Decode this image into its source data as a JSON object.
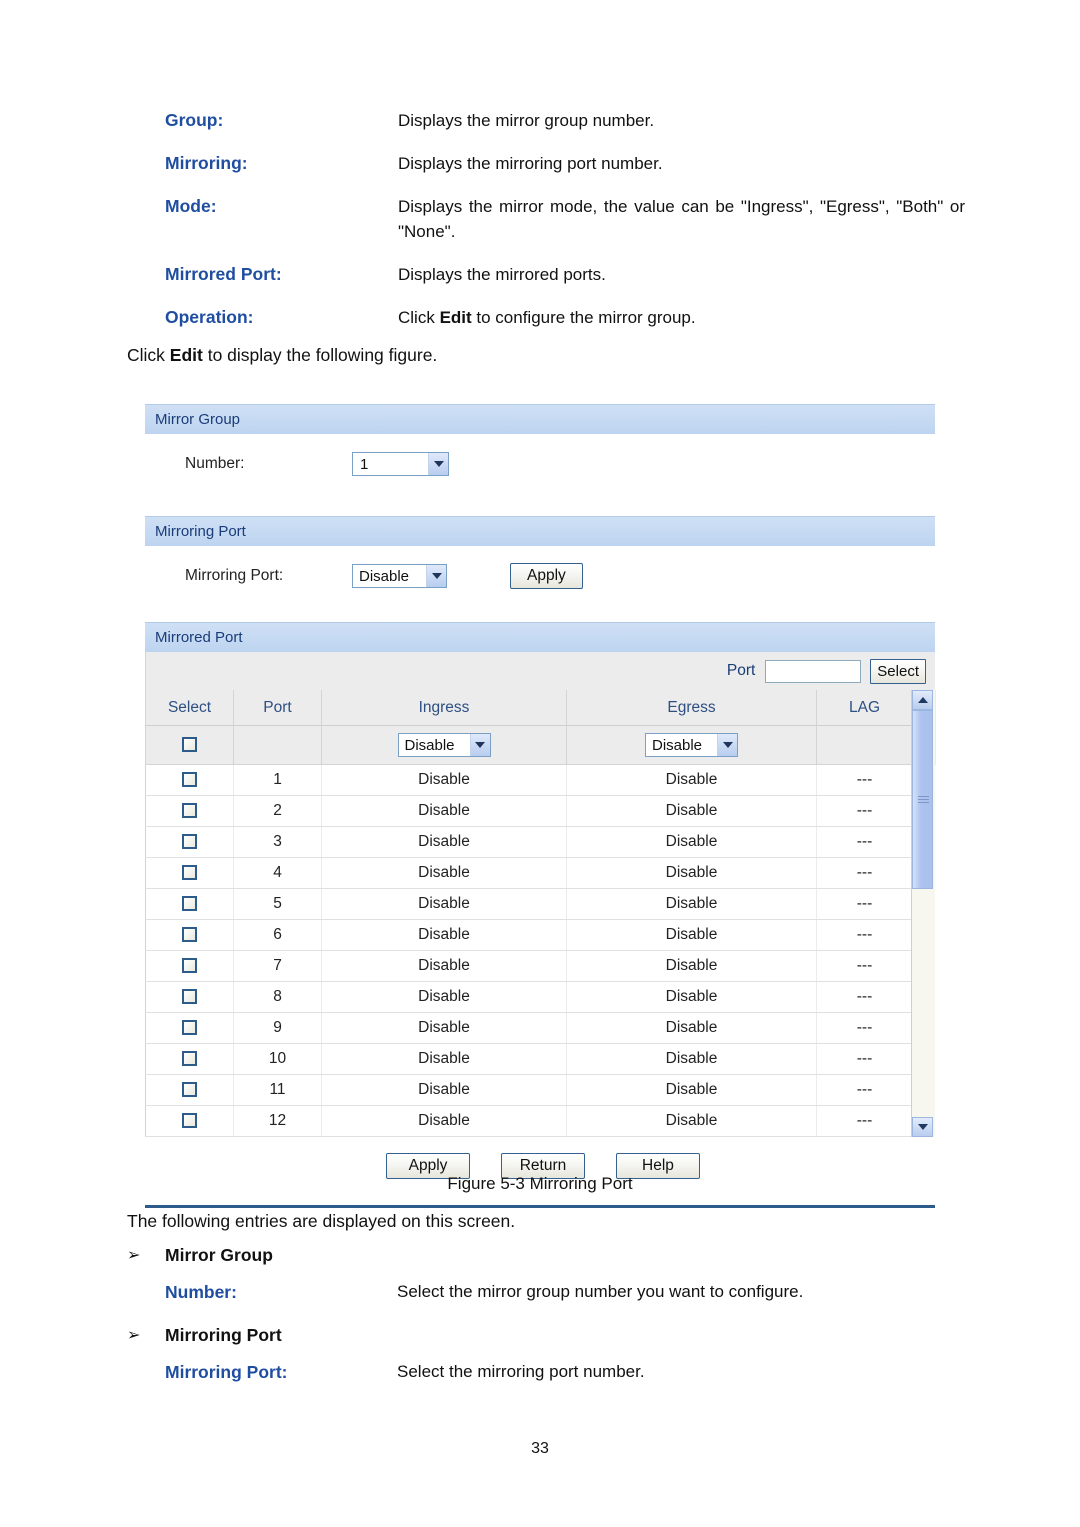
{
  "definitions": [
    {
      "term": "Group:",
      "desc": "Displays the mirror group number."
    },
    {
      "term": "Mirroring:",
      "desc": "Displays the mirroring port number."
    },
    {
      "term": "Mode:",
      "desc": "Displays the mirror mode, the value can be \"Ingress\", \"Egress\", \"Both\" or \"None\"."
    },
    {
      "term": "Mirrored Port:",
      "desc": "Displays the mirrored ports."
    },
    {
      "term": "Operation:",
      "desc_pre": "Click ",
      "desc_bold": "Edit",
      "desc_post": " to configure the mirror group."
    }
  ],
  "click_edit_line": {
    "pre": "Click ",
    "bold": "Edit",
    "post": " to display the following figure."
  },
  "panel": {
    "mirror_group": {
      "title": "Mirror Group",
      "number_label": "Number:",
      "number_value": "1"
    },
    "mirroring_port": {
      "title": "Mirroring Port",
      "label": "Mirroring Port:",
      "value": "Disable",
      "apply_label": "Apply"
    },
    "mirrored_port": {
      "title": "Mirrored Port",
      "search_label": "Port",
      "search_value": "",
      "search_placeholder": "",
      "select_button": "Select",
      "columns": [
        "Select",
        "Port",
        "Ingress",
        "Egress",
        "LAG"
      ],
      "control_row": {
        "ingress": "Disable",
        "egress": "Disable"
      },
      "rows": [
        {
          "port": "1",
          "ingress": "Disable",
          "egress": "Disable",
          "lag": "---"
        },
        {
          "port": "2",
          "ingress": "Disable",
          "egress": "Disable",
          "lag": "---"
        },
        {
          "port": "3",
          "ingress": "Disable",
          "egress": "Disable",
          "lag": "---"
        },
        {
          "port": "4",
          "ingress": "Disable",
          "egress": "Disable",
          "lag": "---"
        },
        {
          "port": "5",
          "ingress": "Disable",
          "egress": "Disable",
          "lag": "---"
        },
        {
          "port": "6",
          "ingress": "Disable",
          "egress": "Disable",
          "lag": "---"
        },
        {
          "port": "7",
          "ingress": "Disable",
          "egress": "Disable",
          "lag": "---"
        },
        {
          "port": "8",
          "ingress": "Disable",
          "egress": "Disable",
          "lag": "---"
        },
        {
          "port": "9",
          "ingress": "Disable",
          "egress": "Disable",
          "lag": "---"
        },
        {
          "port": "10",
          "ingress": "Disable",
          "egress": "Disable",
          "lag": "---"
        },
        {
          "port": "11",
          "ingress": "Disable",
          "egress": "Disable",
          "lag": "---"
        },
        {
          "port": "12",
          "ingress": "Disable",
          "egress": "Disable",
          "lag": "---"
        }
      ]
    },
    "footer_buttons": {
      "apply": "Apply",
      "return": "Return",
      "help": "Help"
    }
  },
  "figure_caption": "Figure 5-3 Mirroring Port",
  "following_line": "The following entries are displayed on this screen.",
  "bullets": [
    {
      "marker": "➢",
      "title": "Mirror Group",
      "sub": {
        "term": "Number:",
        "desc": "Select the mirror group number you want to configure."
      }
    },
    {
      "marker": "➢",
      "title": "Mirroring Port",
      "sub": {
        "term": "Mirroring Port:",
        "desc": "Select the mirroring port number."
      }
    }
  ],
  "page_number": "33",
  "colors": {
    "term_blue": "#1f4ea1",
    "panel_header": "#c5d9f1",
    "panel_header_text": "#1a3c78",
    "rule": "#2e5c8a"
  }
}
